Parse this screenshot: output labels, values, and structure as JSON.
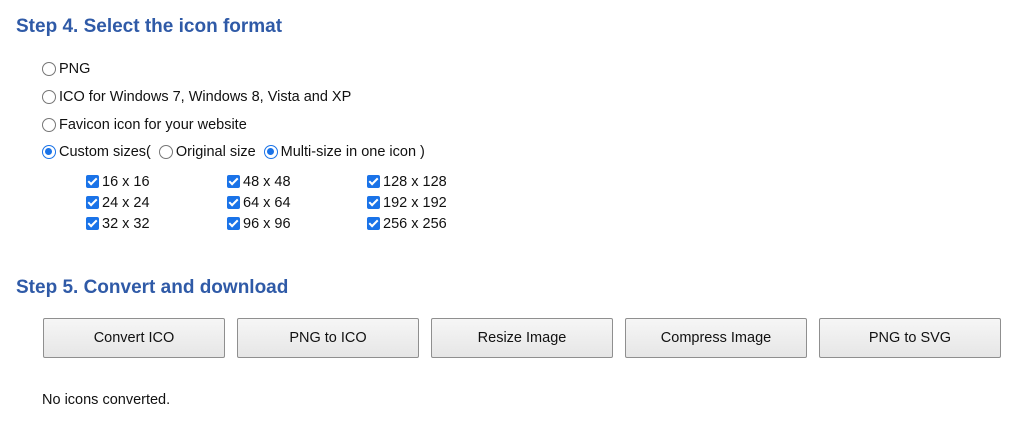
{
  "step4": {
    "title": "Step 4. Select the icon format",
    "options": [
      {
        "label": "PNG",
        "selected": false
      },
      {
        "label": "ICO for Windows 7, Windows 8, Vista and XP",
        "selected": false
      },
      {
        "label": "Favicon icon for your website",
        "selected": false
      },
      {
        "label": "Custom sizes(",
        "selected": true
      }
    ],
    "custom_modes": [
      {
        "label": "Original size",
        "selected": false
      },
      {
        "label": "Multi-size in one icon )",
        "selected": true
      }
    ],
    "sizes": [
      [
        {
          "label": "16 x 16",
          "checked": true
        },
        {
          "label": "24 x 24",
          "checked": true
        },
        {
          "label": "32 x 32",
          "checked": true
        }
      ],
      [
        {
          "label": "48 x 48",
          "checked": true
        },
        {
          "label": "64 x 64",
          "checked": true
        },
        {
          "label": "96 x 96",
          "checked": true
        }
      ],
      [
        {
          "label": "128 x 128",
          "checked": true
        },
        {
          "label": "192 x 192",
          "checked": true
        },
        {
          "label": "256 x 256",
          "checked": true
        }
      ]
    ]
  },
  "step5": {
    "title": "Step 5. Convert and download",
    "buttons": [
      "Convert ICO",
      "PNG to ICO",
      "Resize Image",
      "Compress Image",
      "PNG to SVG"
    ]
  },
  "status": "No icons converted.",
  "colors": {
    "heading": "#2f5aa7",
    "accent": "#1a73e8"
  }
}
